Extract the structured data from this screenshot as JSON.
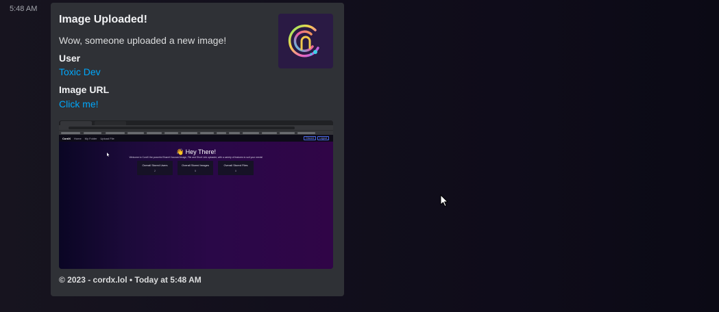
{
  "message": {
    "timestamp": "5:48 AM",
    "embed": {
      "title": "Image Uploaded!",
      "description": "Wow, someone uploaded a new image!",
      "fields": [
        {
          "name": "User",
          "value": "Toxic Dev"
        },
        {
          "name": "Image URL",
          "value": "Click me!"
        }
      ],
      "footer": "© 2023 - cordx.lol • Today at 5:48 AM",
      "thumbnail_icon": "cordx-logo-icon",
      "link_color": "#00a8fc"
    }
  },
  "screenshot": {
    "nav": {
      "brand": "CordX",
      "links": [
        "Home",
        "My Folder",
        "Upload File"
      ],
      "buttons": [
        "Discord",
        "Logout"
      ]
    },
    "heading": "👋 Hey There!",
    "welcome": "Welcome to CordX the powerful ShareX focused Image, File and Short Link uploader, with a variety of features to suit your needs!",
    "stats": [
      {
        "title": "Overall Stored Users",
        "value": "2"
      },
      {
        "title": "Overall Stored Images",
        "value": "5"
      },
      {
        "title": "Overall Stored Files",
        "value": "0"
      }
    ]
  }
}
